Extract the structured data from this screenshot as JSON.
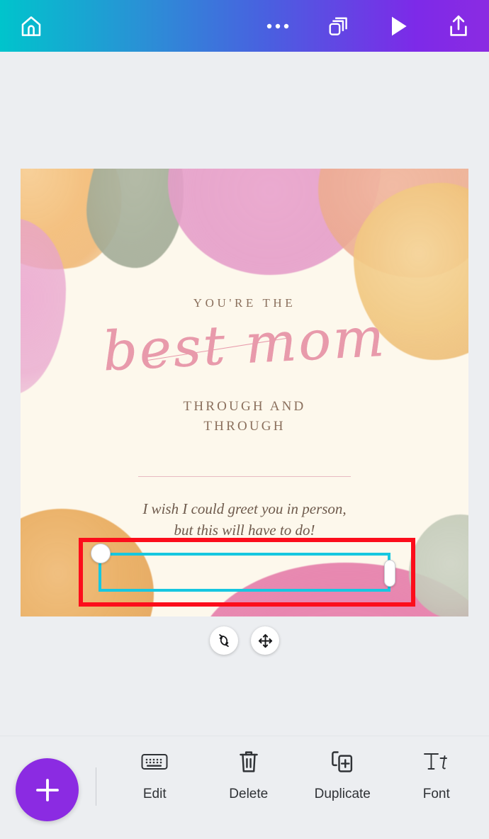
{
  "app": {
    "name": "Canva Mobile Editor",
    "accent_purple": "#8b2be2",
    "accent_teal": "#00c4cc",
    "selection_red": "#fc0d1b",
    "selection_cyan": "#16c7e0",
    "workspace_bg": "#eceef1",
    "canvas_bg": "#fdf8ec"
  },
  "topbar": {
    "home_icon": "home-icon",
    "more_icon": "more-options-icon",
    "pages_icon": "pages-icon",
    "play_icon": "play-icon",
    "share_icon": "share-upload-icon"
  },
  "design": {
    "eyebrow": "YOU'RE THE",
    "script_word_1": "best",
    "script_word_2": "mom",
    "subline_line_1": "THROUGH AND",
    "subline_line_2": "THROUGH",
    "eyebrow_color": "#8a6f5c",
    "script_color": "#e89aab",
    "divider_color": "#e7b9c2",
    "selected_textbox": {
      "line_1": "I wish I could greet you in person,",
      "line_2": "but this will have to do!",
      "text_color": "#6e5a4c"
    }
  },
  "canvas_controls": {
    "rotate_icon": "rotate-icon",
    "move_icon": "move-icon",
    "resize_handle_corner": "resize-handle-circle",
    "resize_handle_side": "resize-handle-bar"
  },
  "bottombar": {
    "add_label": "+",
    "add_icon": "plus-icon",
    "tools": [
      {
        "label": "Edit",
        "icon": "keyboard-icon"
      },
      {
        "label": "Delete",
        "icon": "trash-icon"
      },
      {
        "label": "Duplicate",
        "icon": "duplicate-icon"
      },
      {
        "label": "Font",
        "icon": "font-icon"
      }
    ]
  }
}
